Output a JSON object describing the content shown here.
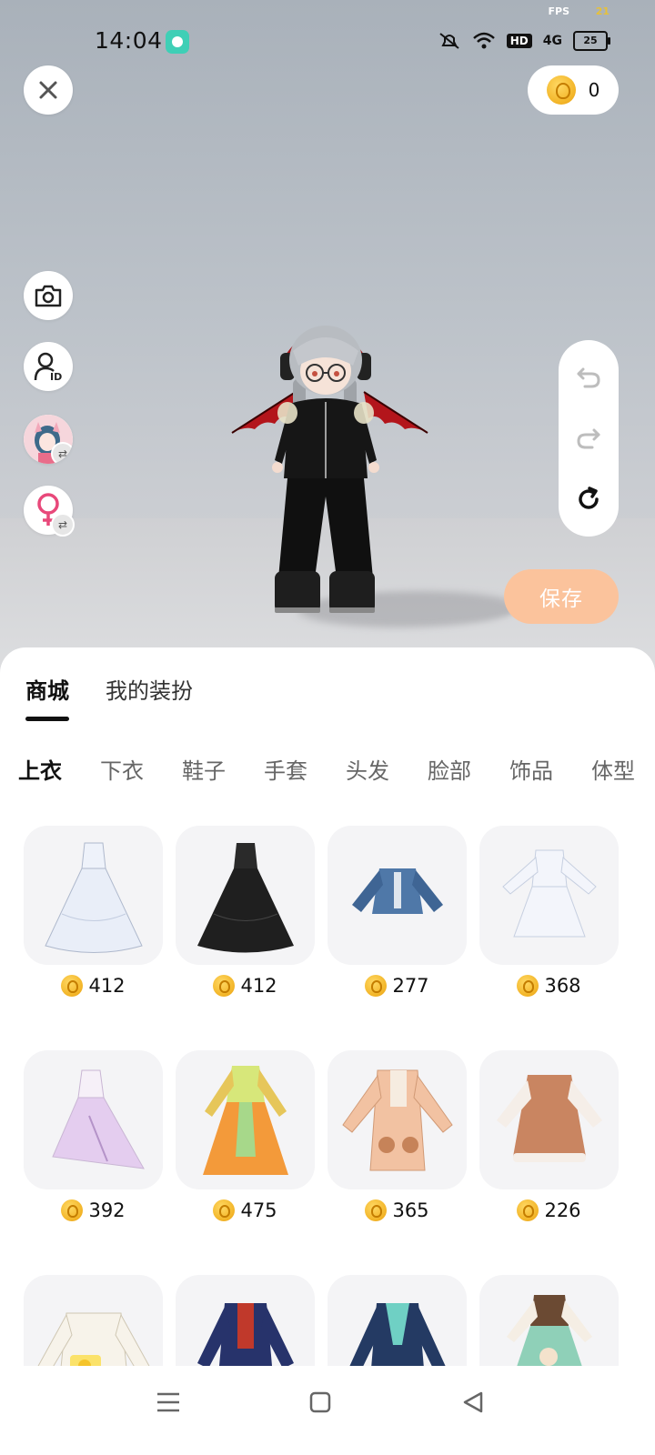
{
  "status_bar": {
    "time": "14:04",
    "fps_label": "FPS",
    "fps_value": "21",
    "network": "4G",
    "hd": "HD",
    "battery": "25"
  },
  "coins": {
    "balance": "0"
  },
  "buttons": {
    "save_label": "保存"
  },
  "main_tabs": [
    {
      "label": "商城",
      "active": true
    },
    {
      "label": "我的装扮",
      "active": false
    }
  ],
  "categories": [
    {
      "label": "上衣",
      "active": true
    },
    {
      "label": "下衣"
    },
    {
      "label": "鞋子"
    },
    {
      "label": "手套"
    },
    {
      "label": "头发"
    },
    {
      "label": "脸部"
    },
    {
      "label": "饰品"
    },
    {
      "label": "体型"
    }
  ],
  "items": [
    {
      "icon": "white-gown-icon",
      "color": "#e9eef8",
      "price": "412"
    },
    {
      "icon": "black-gown-icon",
      "color": "#222222",
      "price": "412"
    },
    {
      "icon": "denim-jacket-icon",
      "color": "#4f78a8",
      "price": "277"
    },
    {
      "icon": "white-lolita-dress-icon",
      "color": "#f3f5fb",
      "price": "368"
    },
    {
      "icon": "lilac-fairy-dress-icon",
      "color": "#d9b9e8",
      "price": "392"
    },
    {
      "icon": "green-orange-robe-icon",
      "color": "#f39a3a",
      "price": "475"
    },
    {
      "icon": "peach-bear-coat-icon",
      "color": "#f2c2a2",
      "price": "365"
    },
    {
      "icon": "brown-cape-dress-icon",
      "color": "#c98561",
      "price": "226"
    },
    {
      "icon": "duck-sweater-icon",
      "color": "#f7f3ea",
      "price": ""
    },
    {
      "icon": "navy-red-jacket-icon",
      "color": "#27336b",
      "price": ""
    },
    {
      "icon": "navy-teal-robe-icon",
      "color": "#243a63",
      "price": ""
    },
    {
      "icon": "green-floral-dress-icon",
      "color": "#8fd0b8",
      "price": ""
    }
  ]
}
